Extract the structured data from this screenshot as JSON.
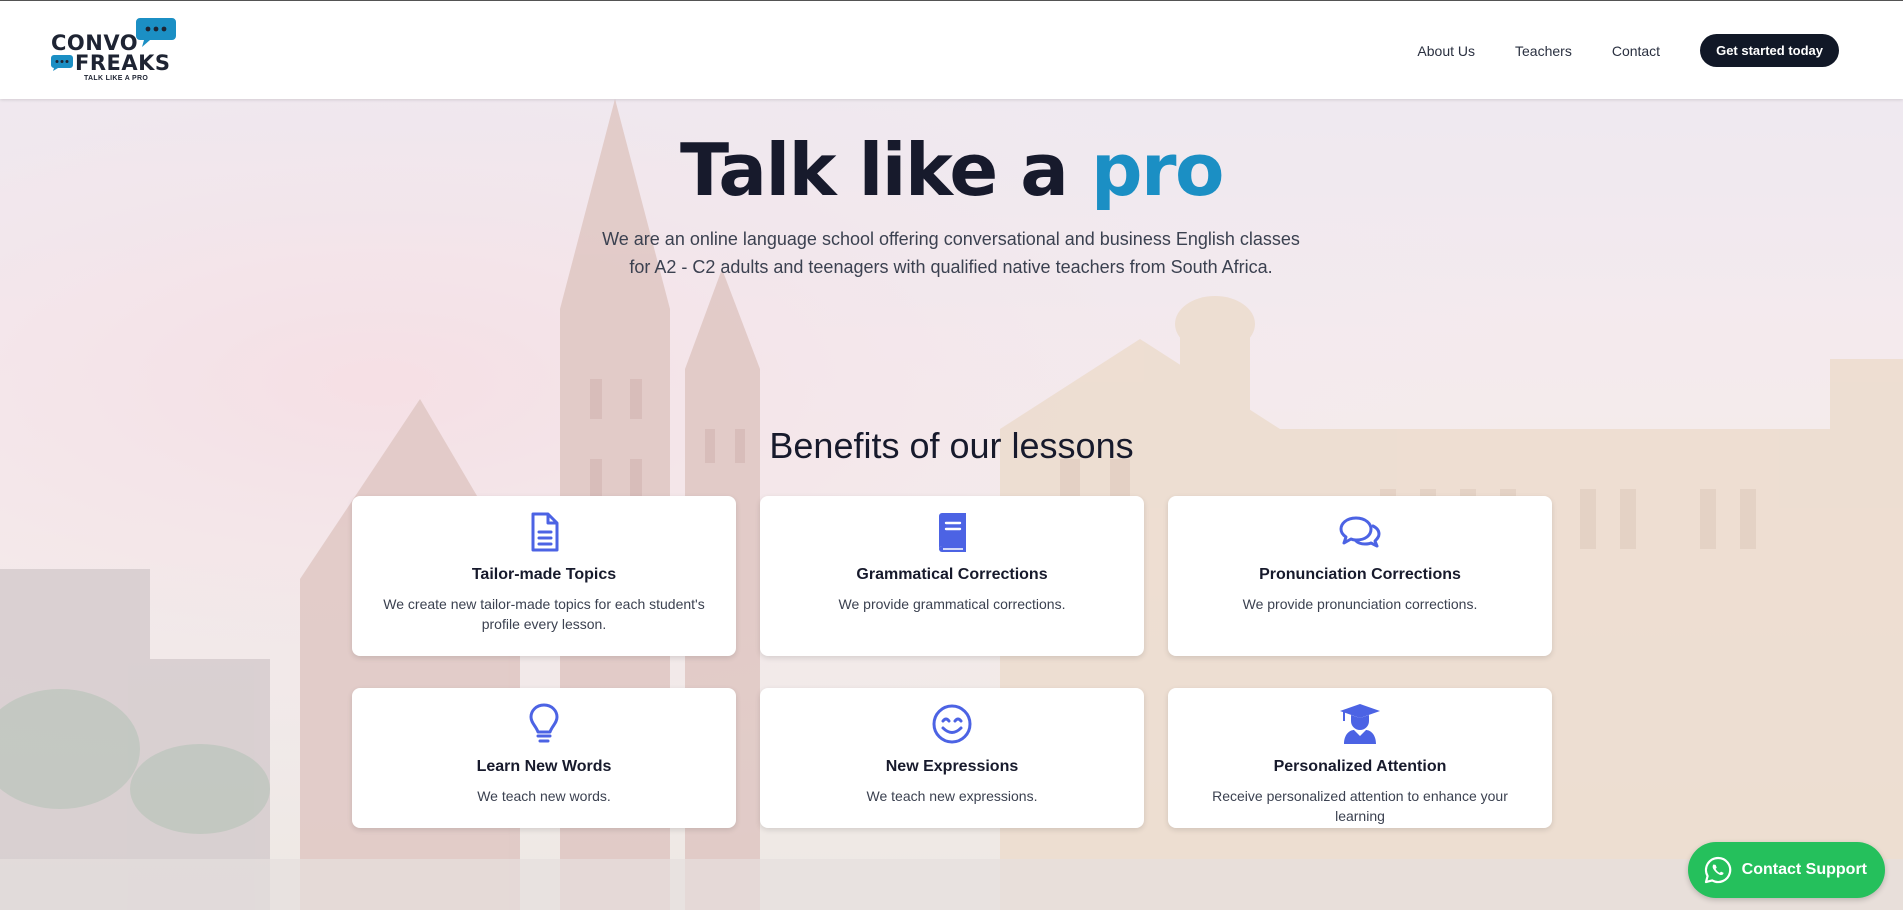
{
  "brand": {
    "logo_word1": "CONVO",
    "logo_word2": "FREAKS",
    "tagline": "TALK LIKE A PRO",
    "accent_color": "#1b8fc4"
  },
  "nav": {
    "items": [
      {
        "label": "About Us"
      },
      {
        "label": "Teachers"
      },
      {
        "label": "Contact"
      }
    ],
    "cta_label": "Get started today"
  },
  "hero": {
    "title_main": "Talk like a ",
    "title_accent": "pro",
    "subtitle": "We are an online language school offering conversational and business English classes for A2 - C2 adults and teenagers with qualified native teachers from South Africa."
  },
  "benefits": {
    "heading": "Benefits of our lessons",
    "cards": [
      {
        "icon": "document-icon",
        "title": "Tailor-made Topics",
        "text": "We create new tailor-made topics for each student's profile every lesson."
      },
      {
        "icon": "book-icon",
        "title": "Grammatical Corrections",
        "text": "We provide grammatical corrections."
      },
      {
        "icon": "chat-bubbles-icon",
        "title": "Pronunciation Corrections",
        "text": "We provide pronunciation corrections."
      },
      {
        "icon": "lightbulb-icon",
        "title": "Learn New Words",
        "text": "We teach new words."
      },
      {
        "icon": "smiley-icon",
        "title": "New Expressions",
        "text": "We teach new expressions."
      },
      {
        "icon": "graduate-icon",
        "title": "Personalized Attention",
        "text": "Receive personalized attention to enhance your learning"
      }
    ]
  },
  "support": {
    "label": "Contact Support",
    "icon": "whatsapp-icon",
    "color": "#25c05c"
  }
}
